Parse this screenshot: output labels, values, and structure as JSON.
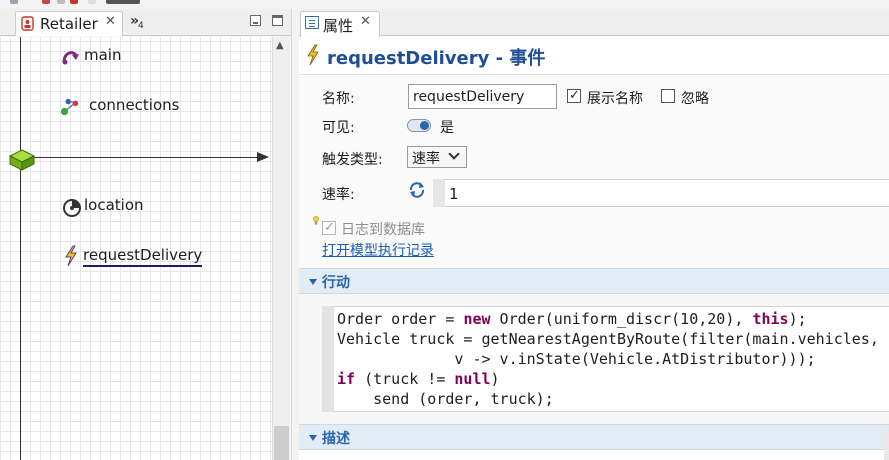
{
  "left_panel": {
    "tab_label": "Retailer",
    "overflow_count": "4",
    "canvas_items": [
      {
        "id": "main",
        "label": "main",
        "icon": "agent-type-icon"
      },
      {
        "id": "connections",
        "label": "connections",
        "icon": "connections-icon"
      },
      {
        "id": "location",
        "label": "location",
        "icon": "location-icon"
      },
      {
        "id": "requestDelivery",
        "label": "requestDelivery",
        "icon": "event-bolt-icon"
      }
    ]
  },
  "right_panel": {
    "tab_label": "属性",
    "header_title": "requestDelivery - 事件",
    "form": {
      "name_label": "名称:",
      "name_value": "requestDelivery",
      "show_name_label": "展示名称",
      "show_name_checked": true,
      "ignore_label": "忽略",
      "ignore_checked": false,
      "visible_label": "可见:",
      "visible_value": "是",
      "trigger_label": "触发类型:",
      "trigger_value": "速率",
      "rate_label": "速率:",
      "rate_value": "1",
      "log_label": "日志到数据库",
      "log_checked": true,
      "open_log_link": "打开模型执行记录"
    },
    "sections": {
      "action_title": "行动",
      "description_title": "描述"
    },
    "action_code": {
      "line1_a": "Order order = ",
      "line1_kw1": "new",
      "line1_b": " Order(uniform_discr(10,20), ",
      "line1_kw2": "this",
      "line1_c": ");",
      "line2": "Vehicle truck = getNearestAgentByRoute(filter(main.vehicles,",
      "line3": "             v -> v.inState(Vehicle.AtDistributor)));",
      "line4_kw1": "if",
      "line4_a": " (truck != ",
      "line4_kw2": "null",
      "line4_b": ")",
      "line5": "    send (order, truck);"
    }
  },
  "colors": {
    "title_blue": "#1f4e96",
    "section_blue": "#2a64b0",
    "link_blue": "#1a5fb4",
    "keyword": "#7f0055",
    "origin_green": "#7ec520"
  }
}
